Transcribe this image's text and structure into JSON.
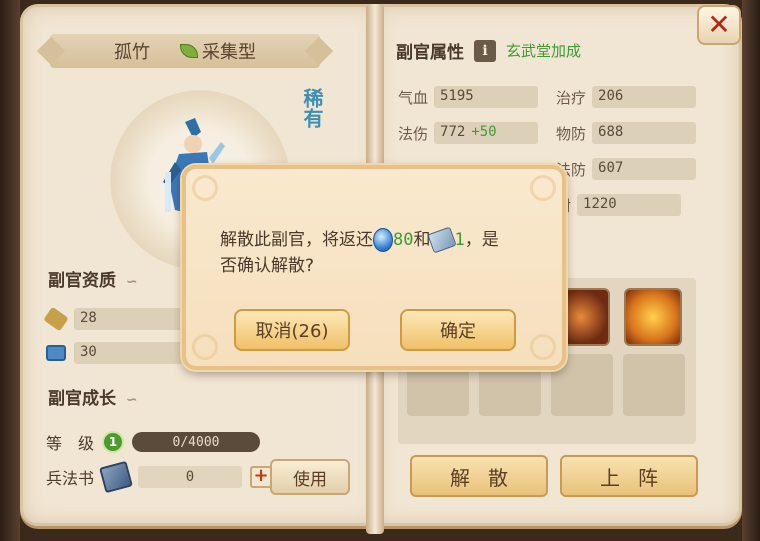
{
  "left_page": {
    "hero_name": "孤竹",
    "hero_type": "采集型",
    "rarity": "稀有",
    "aptitude_title": "副官资质",
    "aptitude_rows": [
      {
        "icon": "sword-scroll-icon",
        "value": "28"
      },
      {
        "icon": "armor-icon",
        "value": "30"
      }
    ],
    "growth_title": "副官成长",
    "level_label": "等　级",
    "level": "1",
    "exp": "0/4000",
    "book_label": "兵法书",
    "book_qty": "0",
    "use_button": "使用"
  },
  "right_page": {
    "title": "副官属性",
    "info_button": "i",
    "bonus_text": "玄武堂加成",
    "attributes": [
      {
        "label": "气血",
        "value": "5195",
        "bonus": ""
      },
      {
        "label": "治疗",
        "value": "206",
        "bonus": ""
      },
      {
        "label": "法伤",
        "value": "772",
        "bonus": "+50"
      },
      {
        "label": "物防",
        "value": "688",
        "bonus": ""
      },
      {
        "label": "",
        "value": "",
        "bonus": ""
      },
      {
        "label": "法防",
        "value": "607",
        "bonus": ""
      },
      {
        "label": "",
        "value": "",
        "bonus": ""
      },
      {
        "label": "封",
        "value": "1220",
        "bonus": ""
      }
    ],
    "dismiss_button": "解散",
    "deploy_button": "上阵"
  },
  "dialog": {
    "line1_prefix": "解散此副官，将返还",
    "gem_amount": "80",
    "conjunction": "和",
    "book_amount": "1",
    "line1_suffix": "，是",
    "line2": "否确认解散?",
    "cancel_button": "取消(26)",
    "confirm_button": "确定"
  },
  "close_button": "✕",
  "colors": {
    "bonus_green": "#3e9b32",
    "rarity_blue": "#3f8fb5",
    "close_red": "#b3261e"
  }
}
